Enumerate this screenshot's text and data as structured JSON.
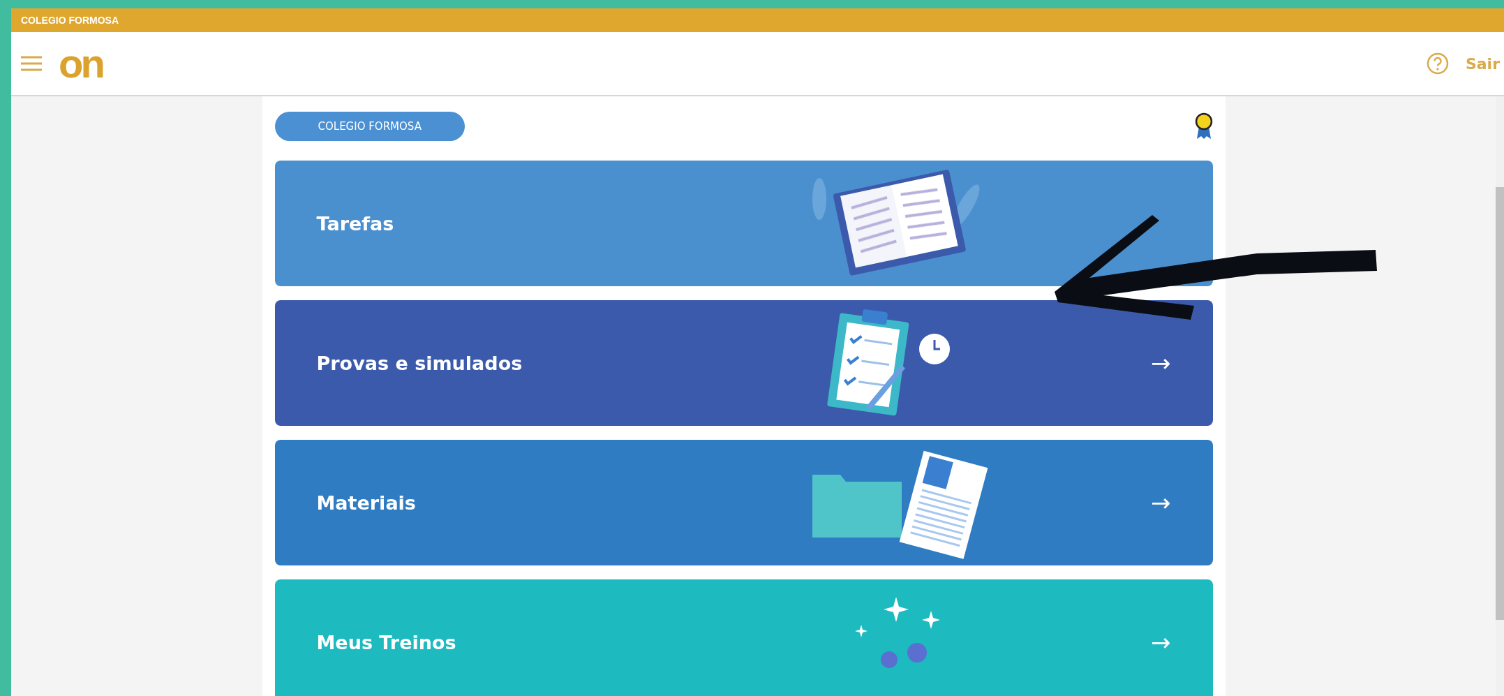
{
  "top_bar": {
    "title": "COLEGIO FORMOSA"
  },
  "header": {
    "logo": "on",
    "logout": "Sair"
  },
  "school_pill": "COLEGIO FORMOSA",
  "cards": [
    {
      "label": "Tarefas",
      "kind": "book",
      "color": "#4a90cf"
    },
    {
      "label": "Provas e simulados",
      "kind": "clipboard",
      "color": "#3c5aab",
      "arrow": "→"
    },
    {
      "label": "Materiais",
      "kind": "folder",
      "color": "#2f7cc3",
      "arrow": "→"
    },
    {
      "label": "Meus Treinos",
      "kind": "sparkles",
      "color": "#1dbac0",
      "arrow": "→"
    }
  ]
}
